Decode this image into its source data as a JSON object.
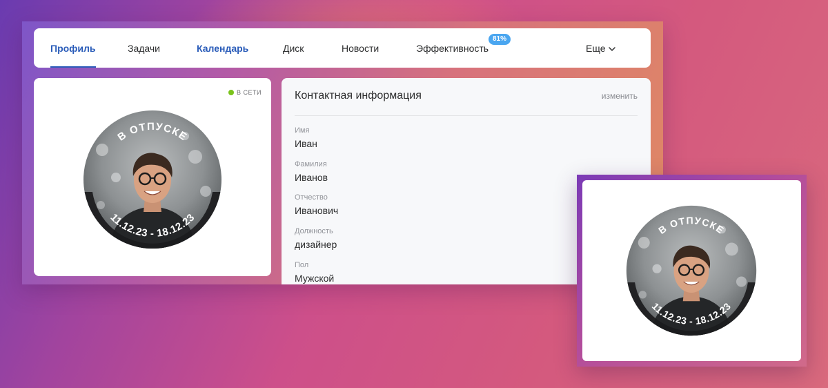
{
  "tabs": [
    {
      "label": "Профиль",
      "state": "active"
    },
    {
      "label": "Задачи",
      "state": "normal"
    },
    {
      "label": "Календарь",
      "state": "link"
    },
    {
      "label": "Диск",
      "state": "normal"
    },
    {
      "label": "Новости",
      "state": "normal"
    },
    {
      "label": "Эффективность",
      "state": "normal"
    }
  ],
  "efficiency_badge": "81%",
  "more_label": "Еще",
  "status": {
    "label": "В СЕТИ",
    "color": "#7ac31b"
  },
  "avatar": {
    "top_text": "В ОТПУСКЕ",
    "bottom_text": "11.12.23 - 18.12.23",
    "ring_color": "#1b1b1d"
  },
  "contact": {
    "title": "Контактная информация",
    "edit_label": "изменить",
    "fields": [
      {
        "label": "Имя",
        "value": "Иван"
      },
      {
        "label": "Фамилия",
        "value": "Иванов"
      },
      {
        "label": "Отчество",
        "value": "Иванович"
      },
      {
        "label": "Должность",
        "value": "дизайнер"
      },
      {
        "label": "Пол",
        "value": "Мужской"
      }
    ]
  },
  "colors": {
    "accent": "#2a5cb9",
    "badge": "#4aa6f0"
  }
}
